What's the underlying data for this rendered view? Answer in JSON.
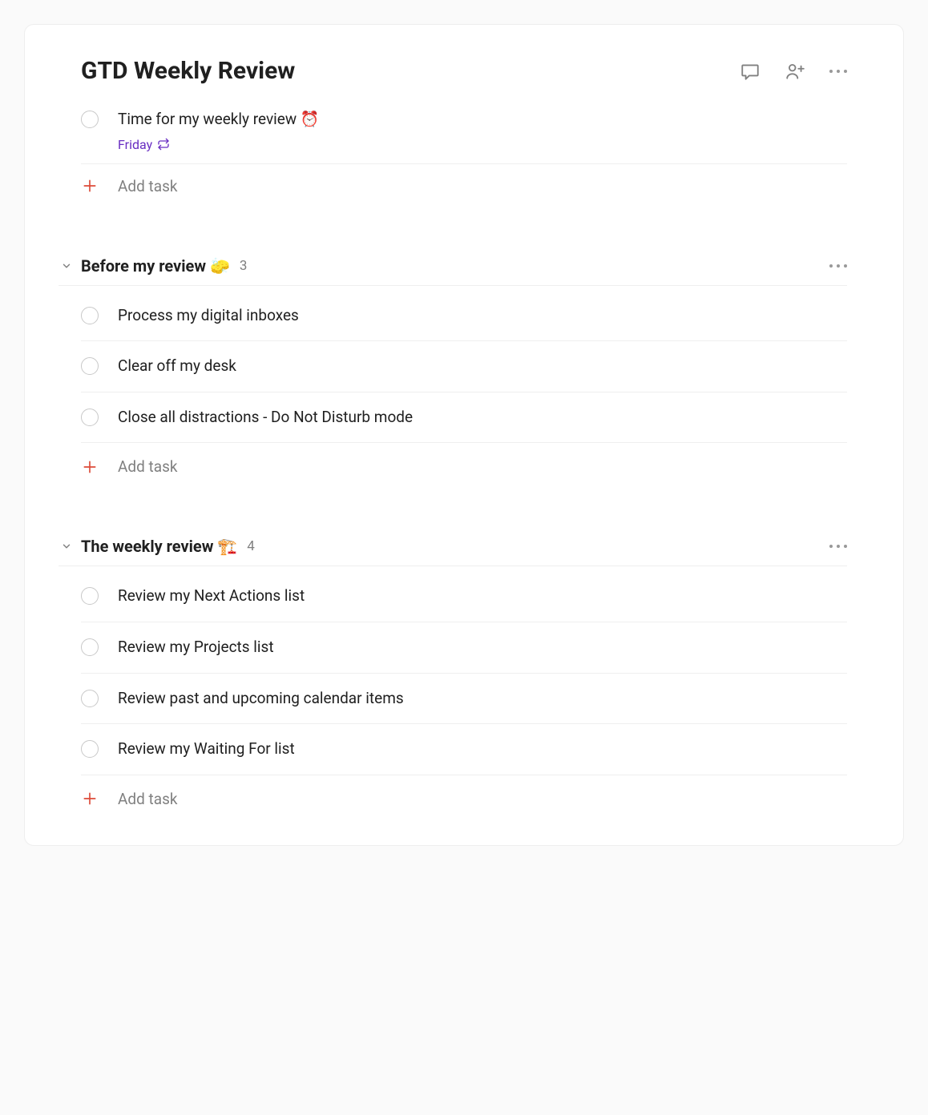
{
  "header": {
    "title": "GTD Weekly Review"
  },
  "primary_task": {
    "title": "Time for my weekly review ⏰",
    "date": "Friday"
  },
  "add_task_label": "Add task",
  "sections": [
    {
      "title": "Before my review 🧽",
      "count": "3",
      "tasks": [
        "Process my digital inboxes",
        "Clear off my desk",
        "Close all distractions - Do Not Disturb mode"
      ]
    },
    {
      "title": "The weekly review 🏗️",
      "count": "4",
      "tasks": [
        "Review my Next Actions list",
        "Review my Projects list",
        "Review past and upcoming calendar items",
        "Review my Waiting For list"
      ]
    }
  ]
}
